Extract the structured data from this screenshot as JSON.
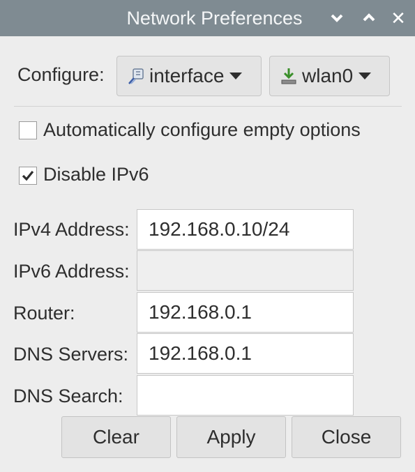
{
  "window": {
    "title": "Network Preferences",
    "controls": {
      "minimize_icon": "chevron-down-icon",
      "maximize_icon": "chevron-up-icon",
      "close_icon": "close-icon",
      "close_glyph": "✕"
    }
  },
  "configure": {
    "label": "Configure:",
    "type_dropdown": {
      "value": "interface",
      "icon": "network-plug-icon"
    },
    "device_dropdown": {
      "value": "wlan0",
      "icon": "download-arrow-icon"
    }
  },
  "options": {
    "auto_configure": {
      "label": "Automatically configure empty options",
      "checked": false
    },
    "disable_ipv6": {
      "label": "Disable IPv6",
      "checked": true
    }
  },
  "fields": {
    "ipv4": {
      "label": "IPv4 Address:",
      "value": "192.168.0.10/24"
    },
    "ipv6": {
      "label": "IPv6 Address:",
      "value": "",
      "disabled": true
    },
    "router": {
      "label": "Router:",
      "value": "192.168.0.1"
    },
    "dns_servers": {
      "label": "DNS Servers:",
      "value": "192.168.0.1"
    },
    "dns_search": {
      "label": "DNS Search:",
      "value": ""
    }
  },
  "buttons": {
    "clear": "Clear",
    "apply": "Apply",
    "close": "Close"
  },
  "colors": {
    "titlebar": "#7f8b92",
    "background": "#ededed",
    "button": "#e3e3e3"
  }
}
